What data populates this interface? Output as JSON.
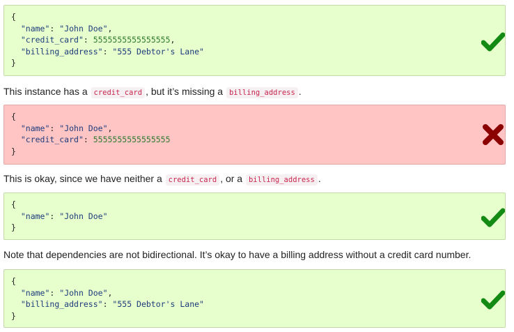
{
  "examples": [
    {
      "status": "valid",
      "status_icon": "checkmark-icon",
      "lines": {
        "open": "{",
        "l1_key": "\"name\"",
        "l1_colon": ": ",
        "l1_val": "\"John Doe\"",
        "l1_end": ",",
        "l2_key": "\"credit_card\"",
        "l2_colon": ": ",
        "l2_val": "5555555555555555",
        "l2_end": ",",
        "l3_key": "\"billing_address\"",
        "l3_colon": ": ",
        "l3_val": "\"555 Debtor's Lane\"",
        "close": "}"
      }
    },
    {
      "status": "invalid",
      "status_icon": "cross-icon",
      "lines": {
        "open": "{",
        "l1_key": "\"name\"",
        "l1_colon": ": ",
        "l1_val": "\"John Doe\"",
        "l1_end": ",",
        "l2_key": "\"credit_card\"",
        "l2_colon": ": ",
        "l2_val": "5555555555555555",
        "close": "}"
      }
    },
    {
      "status": "valid",
      "status_icon": "checkmark-icon",
      "lines": {
        "open": "{",
        "l1_key": "\"name\"",
        "l1_colon": ": ",
        "l1_val": "\"John Doe\"",
        "close": "}"
      }
    },
    {
      "status": "valid",
      "status_icon": "checkmark-icon",
      "lines": {
        "open": "{",
        "l1_key": "\"name\"",
        "l1_colon": ": ",
        "l1_val": "\"John Doe\"",
        "l1_end": ",",
        "l3_key": "\"billing_address\"",
        "l3_colon": ": ",
        "l3_val": "\"555 Debtor's Lane\"",
        "close": "}"
      }
    }
  ],
  "prose": {
    "p1": {
      "a": "This instance has a ",
      "code1": "credit_card",
      "b": ", but it’s missing a ",
      "code2": "billing_address",
      "c": "."
    },
    "p2": {
      "a": "This is okay, since we have neither a ",
      "code1": "credit_card",
      "b": ", or a ",
      "code2": "billing_address",
      "c": "."
    },
    "p3": "Note that dependencies are not bidirectional. It’s okay to have a billing address without a credit card number."
  },
  "colors": {
    "valid_bg": "#e6ffcc",
    "invalid_bg": "#ffc4c4",
    "check_green": "#138a13",
    "cross_red": "#8b0000",
    "inline_code": "#c7254e"
  }
}
